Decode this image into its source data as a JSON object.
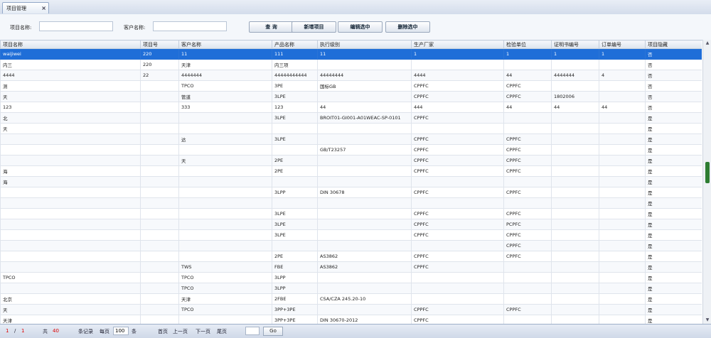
{
  "tab": {
    "title": "项目管理",
    "close": "×"
  },
  "toolbar": {
    "project_name_label": "项目名称:",
    "project_name_value": "",
    "customer_name_label": "客户名称:",
    "customer_name_value": "",
    "query_label": "查 询",
    "add_label": "新增项目",
    "edit_label": "编辑选中",
    "delete_label": "删除选中"
  },
  "table": {
    "columns": [
      "项目名称",
      "项目号",
      "客户名称",
      "产品名称",
      "执行级别",
      "生产厂家",
      "检验单位",
      "证明书编号",
      "订单编号",
      "项目隐藏"
    ],
    "rows": [
      [
        "waijiwei",
        "220",
        "11",
        "111",
        "11",
        "1",
        "1",
        "1",
        "1",
        "否"
      ],
      [
        "内三",
        "220",
        "天津",
        "内三项",
        "",
        "",
        "",
        "",
        "",
        "否"
      ],
      [
        "4444",
        "22",
        "4444444",
        "44444444444",
        "44444444",
        "4444",
        "44",
        "4444444",
        "4",
        "否"
      ],
      [
        "测",
        "",
        "TPCO",
        "3PE",
        "国标GB",
        "CPPFC",
        "CPPFC",
        "",
        "",
        "否"
      ],
      [
        "天",
        "",
        "管道",
        "3LPE",
        "",
        "CPPFC",
        "CPPFC",
        "1802006",
        "",
        "否"
      ],
      [
        "123",
        "",
        "333",
        "123",
        "44",
        "444",
        "44",
        "44",
        "44",
        "否"
      ],
      [
        "北",
        "",
        "",
        "3LPE",
        "BROIT01-GI001-A01WEAC-SP-0101",
        "CPPFC",
        "",
        "",
        "",
        "是"
      ],
      [
        "天",
        "",
        "",
        "",
        "",
        "",
        "",
        "",
        "",
        "是"
      ],
      [
        "",
        "",
        "达",
        "3LPE",
        "",
        "CPPFC",
        "CPPFC",
        "",
        "",
        "是"
      ],
      [
        "",
        "",
        "",
        "",
        "GB/T23257",
        "CPPFC",
        "CPPFC",
        "",
        "",
        "是"
      ],
      [
        "",
        "",
        "天",
        "2PE",
        "",
        "CPPFC",
        "CPPFC",
        "",
        "",
        "是"
      ],
      [
        "海",
        "",
        "",
        "2PE",
        "",
        "CPPFC",
        "CPPFC",
        "",
        "",
        "是"
      ],
      [
        "海",
        "",
        "",
        "",
        "",
        "",
        "",
        "",
        "",
        "是"
      ],
      [
        "",
        "",
        "",
        "3LPP",
        "DIN 30678",
        "CPPFC",
        "CPPFC",
        "",
        "",
        "是"
      ],
      [
        "",
        "",
        "",
        "",
        "",
        "",
        "",
        "",
        "",
        "是"
      ],
      [
        "",
        "",
        "",
        "3LPE",
        "",
        "CPPFC",
        "CPPFC",
        "",
        "",
        "是"
      ],
      [
        "",
        "",
        "",
        "3LPE",
        "",
        "CPPFC",
        "PCPFC",
        "",
        "",
        "是"
      ],
      [
        "",
        "",
        "",
        "3LPE",
        "",
        "CPPFC",
        "CPPFC",
        "",
        "",
        "是"
      ],
      [
        "",
        "",
        "",
        "",
        "",
        "",
        "CPPFC",
        "",
        "",
        "是"
      ],
      [
        "",
        "",
        "",
        "2PE",
        "AS3862",
        "CPPFC",
        "CPPFC",
        "",
        "",
        "是"
      ],
      [
        "",
        "",
        "TWS",
        "FBE",
        "AS3862",
        "CPPFC",
        "",
        "",
        "",
        "是"
      ],
      [
        "TPCO",
        "",
        "TPCO",
        "3LPP",
        "",
        "",
        "",
        "",
        "",
        "是"
      ],
      [
        "",
        "",
        "TPCO",
        "3LPP",
        "",
        "",
        "",
        "",
        "",
        "是"
      ],
      [
        "北京",
        "",
        "天津",
        "2FBE",
        "CSA/CZA 245.20-10",
        "",
        "",
        "",
        "",
        "是"
      ],
      [
        "天",
        "",
        "TPCO",
        "3PP+3PE",
        "",
        "CPPFC",
        "CPPFC",
        "",
        "",
        "是"
      ],
      [
        "天津",
        "",
        "",
        "3PP+3PE",
        "DIN 30670-2012",
        "CPPFC",
        "",
        "",
        "",
        "是"
      ]
    ]
  },
  "pager": {
    "page_current": "1",
    "page_sep": "/",
    "page_total": "1",
    "total_prefix": "共",
    "total_count": "40",
    "total_suffix": "条记录",
    "per_page_label": "每页",
    "per_page_value": "100",
    "per_page_unit": "条",
    "first": "首页",
    "prev": "上一页",
    "next": "下一页",
    "last": "尾页",
    "jump_value": "",
    "go": "Go"
  }
}
